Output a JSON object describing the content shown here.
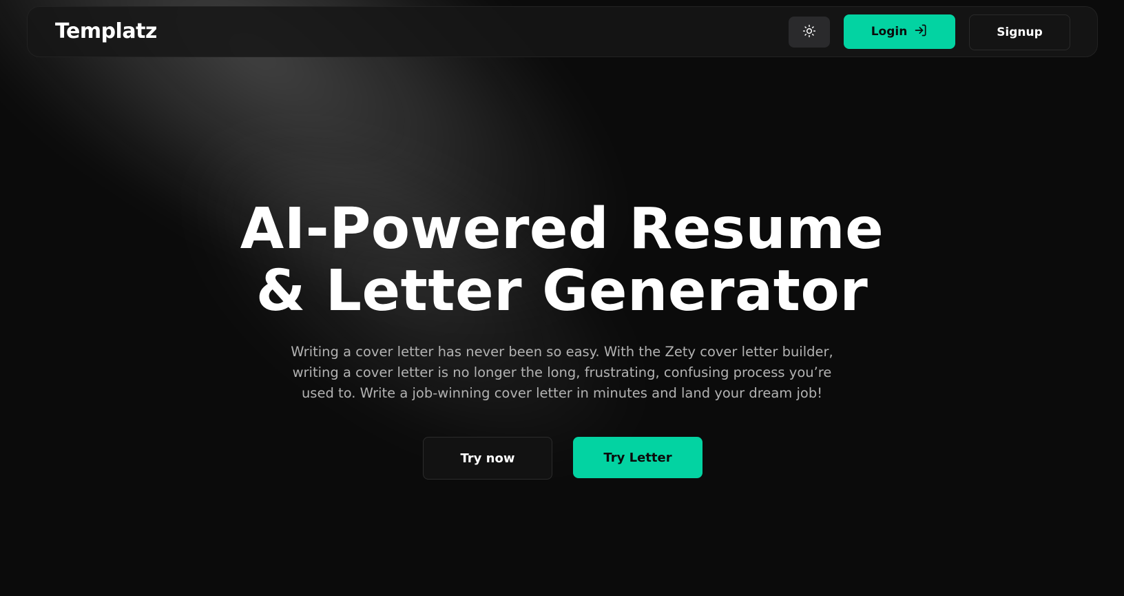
{
  "brand": {
    "name": "Templatz"
  },
  "nav": {
    "theme_toggle_icon": "sun-icon",
    "login_label": "Login",
    "login_icon": "login-arrow-icon",
    "signup_label": "Signup"
  },
  "hero": {
    "title_line1": "AI-Powered Resume",
    "title_line2": "& Letter Generator",
    "subtitle": "Writing a cover letter has never been so easy. With the Zety cover letter builder, writing a cover letter is no longer the long, frustrating, confusing process you’re used to. Write a job-winning cover letter in minutes and land your dream job!"
  },
  "cta": {
    "try_now_label": "Try now",
    "try_letter_label": "Try Letter"
  },
  "colors": {
    "accent": "#03d3a2",
    "background": "#0b0b0b",
    "surface": "#161616"
  }
}
